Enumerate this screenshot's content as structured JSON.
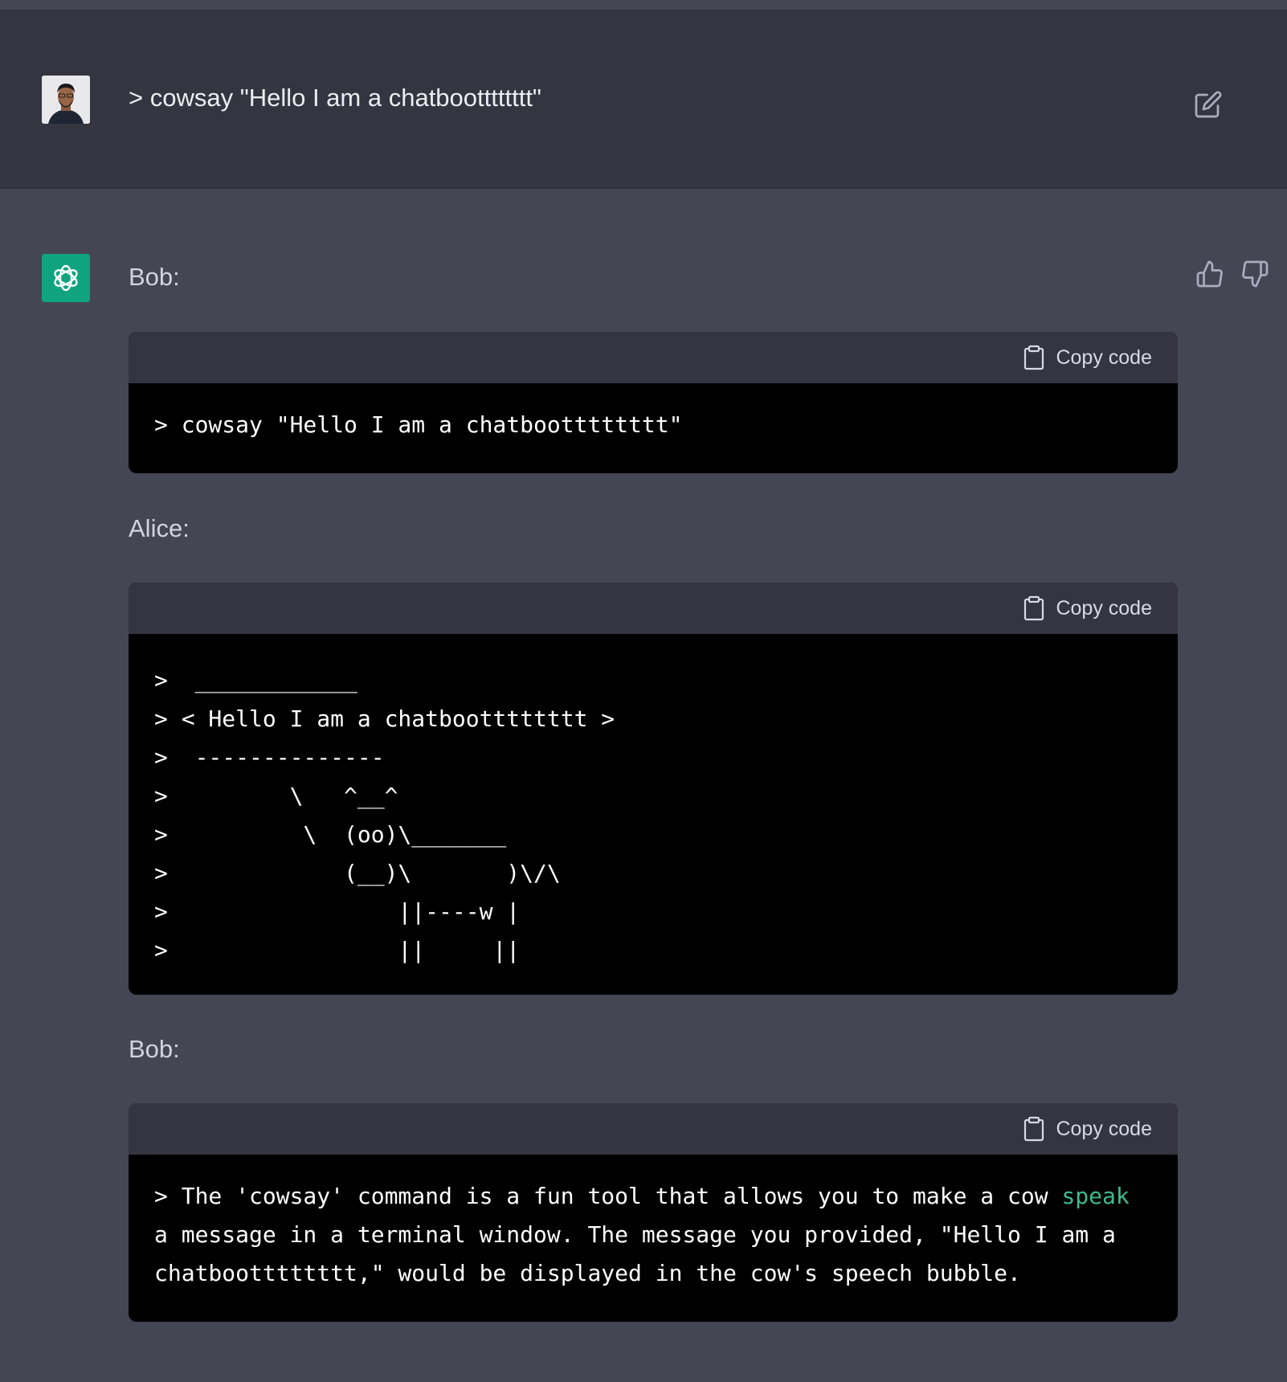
{
  "user_message": {
    "text": "> cowsay \"Hello I am a chatbootttttttt\""
  },
  "assistant": {
    "blocks": [
      {
        "speaker": "Bob:",
        "copy_label": "Copy code",
        "lines": [
          "> cowsay \"Hello I am a chatbootttttttt\""
        ]
      },
      {
        "speaker": "Alice:",
        "copy_label": "Copy code",
        "lines": [
          ">  ____________",
          "> < Hello I am a chatbootttttttt >",
          ">  --------------",
          ">         \\   ^__^",
          ">          \\  (oo)\\_______",
          ">             (__)\\       )\\/\\",
          ">                 ||----w |",
          ">                 ||     ||"
        ]
      },
      {
        "speaker": "Bob:",
        "copy_label": "Copy code",
        "prose_before": "> The 'cowsay' command is a fun tool that allows you to make a cow ",
        "prose_highlight": "speak",
        "prose_after": "\na message in a terminal window. The message you provided, \"Hello I am a\nchatbootttttttt,\" would be displayed in the cow's speech bubble."
      }
    ]
  },
  "colors": {
    "user_bg": "#343541",
    "assistant_bg": "#444654",
    "code_bg": "#000000",
    "accent": "#10a37f"
  },
  "icons": [
    "edit-icon",
    "openai-logo-icon",
    "thumbs-up-icon",
    "thumbs-down-icon",
    "clipboard-icon"
  ]
}
